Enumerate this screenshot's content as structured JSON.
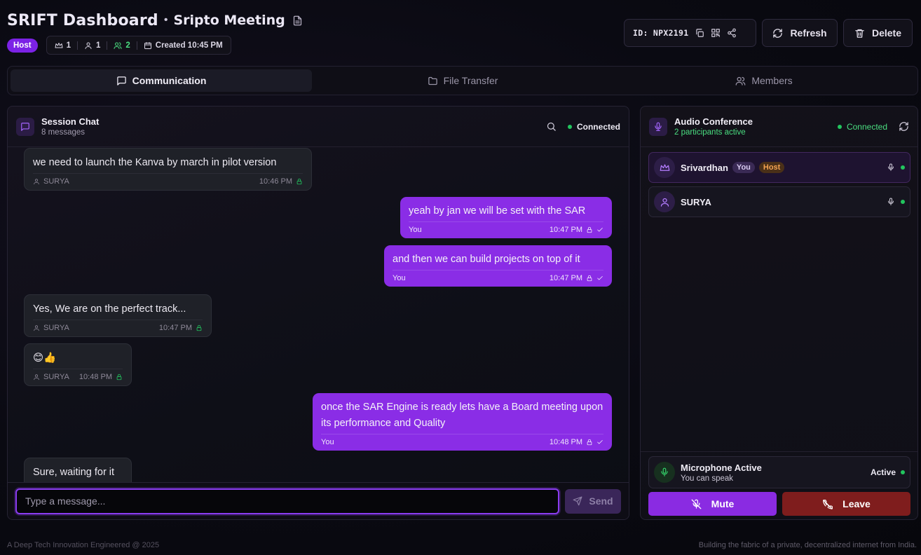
{
  "header": {
    "app_title": "SRIFT Dashboard",
    "separator": "•",
    "meeting_title": "Sripto Meeting",
    "role_badge": "Host",
    "stats": {
      "hosts": "1",
      "users": "1",
      "participants": "2",
      "created": "Created 10:45 PM"
    },
    "session_id": "ID: NPX2191",
    "refresh_label": "Refresh",
    "delete_label": "Delete"
  },
  "tabs": [
    {
      "label": "Communication",
      "active": true
    },
    {
      "label": "File Transfer",
      "active": false
    },
    {
      "label": "Members",
      "active": false
    }
  ],
  "chat": {
    "title": "Session Chat",
    "count": "8 messages",
    "status": "Connected",
    "messages": [
      {
        "dir": "in",
        "text": "we need to launch the Kanva by march in pilot version",
        "user": "SURYA",
        "time": "10:46 PM"
      },
      {
        "dir": "out",
        "text": "yeah by jan we will be set with the SAR",
        "user": "You",
        "time": "10:47 PM"
      },
      {
        "dir": "out",
        "text": "and then we can build projects on top of it",
        "user": "You",
        "time": "10:47 PM"
      },
      {
        "dir": "in",
        "text": "Yes, We are on the perfect track...",
        "user": "SURYA",
        "time": "10:47 PM"
      },
      {
        "dir": "in",
        "text": "😊👍",
        "user": "SURYA",
        "time": "10:48 PM"
      },
      {
        "dir": "out",
        "text": "once the SAR Engine is ready lets have a Board meeting upon its performance and Quality",
        "user": "You",
        "time": "10:48 PM"
      },
      {
        "dir": "in",
        "text": "Sure, waiting for it",
        "user": "",
        "time": ""
      }
    ],
    "input_placeholder": "Type a message...",
    "send_label": "Send"
  },
  "audio": {
    "title": "Audio Conference",
    "subtitle": "2 participants active",
    "status": "Connected",
    "participants": [
      {
        "name": "Srivardhan",
        "you_tag": "You",
        "host_tag": "Host"
      },
      {
        "name": "SURYA"
      }
    ],
    "mic_title": "Microphone Active",
    "mic_sub": "You can speak",
    "mic_state": "Active",
    "mute_label": "Mute",
    "leave_label": "Leave"
  },
  "footer": {
    "left": "A Deep Tech Innovation Engineered @ 2025",
    "right": "Building the fabric of a private, decentralized internet from India."
  },
  "colors": {
    "accent": "#8a2de6",
    "success": "#22c55e",
    "danger": "#7f1d1d",
    "host_badge": "#7c22e6"
  }
}
